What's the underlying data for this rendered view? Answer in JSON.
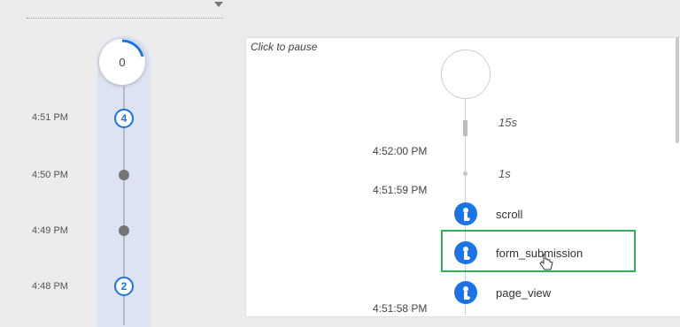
{
  "minutes_timeline": {
    "current_count": "0",
    "rows": [
      {
        "time": "4:51 PM",
        "count": "4"
      },
      {
        "time": "4:50 PM",
        "count": ""
      },
      {
        "time": "4:49 PM",
        "count": ""
      },
      {
        "time": "4:48 PM",
        "count": "2"
      }
    ]
  },
  "seconds_stream": {
    "pause_hint": "Click to pause",
    "gaps": [
      "15s",
      "1s"
    ],
    "timestamps": [
      "4:52:00 PM",
      "4:51:59 PM",
      "4:51:58 PM"
    ],
    "events": [
      {
        "name": "scroll",
        "icon": "touch-icon"
      },
      {
        "name": "form_submission",
        "icon": "touch-icon"
      },
      {
        "name": "page_view",
        "icon": "touch-icon"
      }
    ]
  },
  "colors": {
    "accent": "#1a73e8",
    "highlight": "#2fb35a"
  }
}
